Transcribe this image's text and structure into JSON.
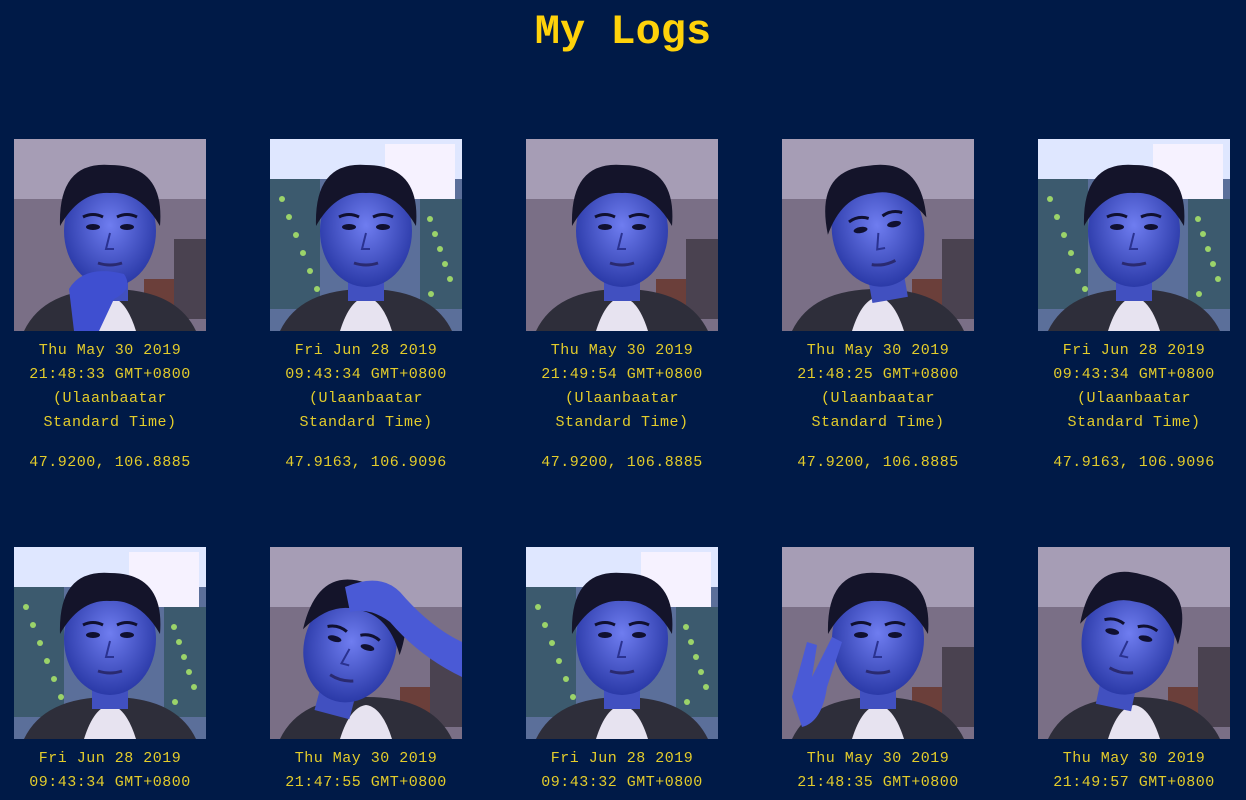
{
  "page": {
    "title": "My Logs"
  },
  "colors": {
    "background": "#001a47",
    "title": "#ffd20a",
    "text": "#e3cc2b"
  },
  "logs": [
    {
      "date": "Thu May 30 2019",
      "time": "21:48:33 GMT+0800",
      "tz1": "(Ulaanbaatar",
      "tz2": "Standard Time)",
      "coords": "47.9200, 106.8885",
      "scene": "room",
      "pose": "hand-chin"
    },
    {
      "date": "Fri Jun 28 2019",
      "time": "09:43:34 GMT+0800",
      "tz1": "(Ulaanbaatar",
      "tz2": "Standard Time)",
      "coords": "47.9163, 106.9096",
      "scene": "office",
      "pose": "neutral"
    },
    {
      "date": "Thu May 30 2019",
      "time": "21:49:54 GMT+0800",
      "tz1": "(Ulaanbaatar",
      "tz2": "Standard Time)",
      "coords": "47.9200, 106.8885",
      "scene": "room",
      "pose": "neutral"
    },
    {
      "date": "Thu May 30 2019",
      "time": "21:48:25 GMT+0800",
      "tz1": "(Ulaanbaatar",
      "tz2": "Standard Time)",
      "coords": "47.9200, 106.8885",
      "scene": "room",
      "pose": "tilt"
    },
    {
      "date": "Fri Jun 28 2019",
      "time": "09:43:34 GMT+0800",
      "tz1": "(Ulaanbaatar",
      "tz2": "Standard Time)",
      "coords": "47.9163, 106.9096",
      "scene": "office",
      "pose": "neutral"
    },
    {
      "date": "Fri Jun 28 2019",
      "time": "09:43:34 GMT+0800",
      "tz1": "",
      "tz2": "",
      "coords": "",
      "scene": "office",
      "pose": "neutral"
    },
    {
      "date": "Thu May 30 2019",
      "time": "21:47:55 GMT+0800",
      "tz1": "",
      "tz2": "",
      "coords": "",
      "scene": "room",
      "pose": "hand-head"
    },
    {
      "date": "Fri Jun 28 2019",
      "time": "09:43:32 GMT+0800",
      "tz1": "",
      "tz2": "",
      "coords": "",
      "scene": "office",
      "pose": "neutral"
    },
    {
      "date": "Thu May 30 2019",
      "time": "21:48:35 GMT+0800",
      "tz1": "",
      "tz2": "",
      "coords": "",
      "scene": "room",
      "pose": "peace"
    },
    {
      "date": "Thu May 30 2019",
      "time": "21:49:57 GMT+0800",
      "tz1": "",
      "tz2": "",
      "coords": "",
      "scene": "room",
      "pose": "tilt-left"
    }
  ]
}
